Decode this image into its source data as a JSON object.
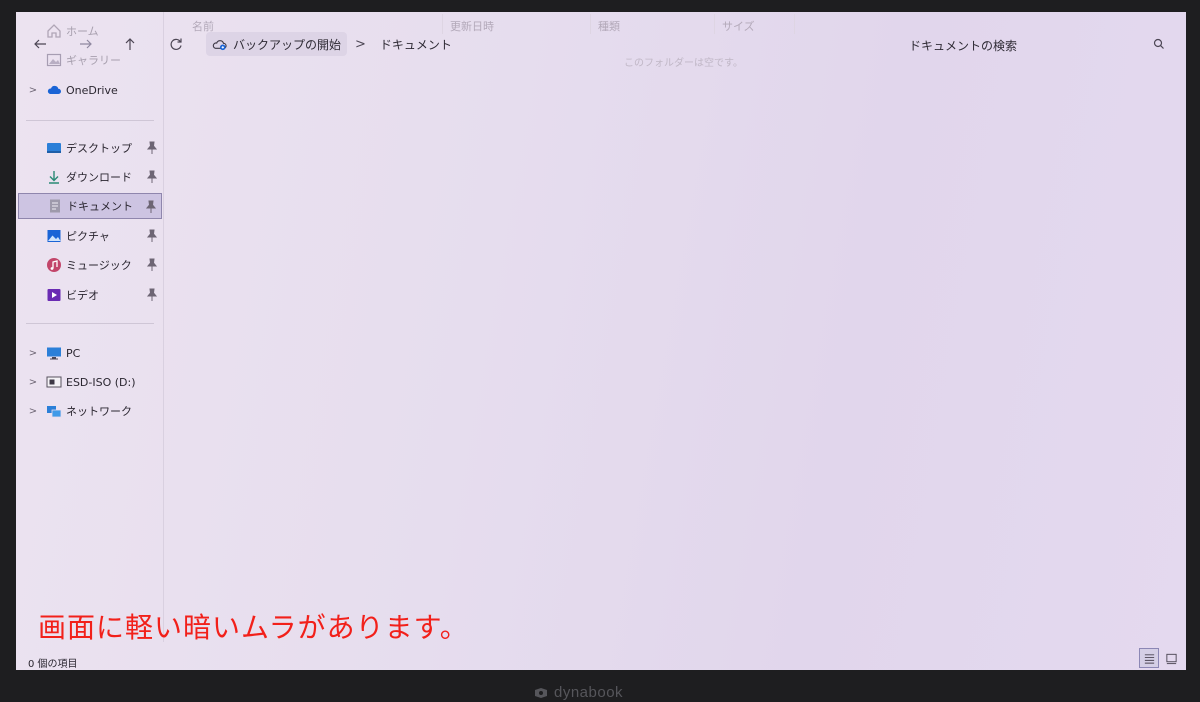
{
  "explorer": {
    "columns": {
      "name": "名前",
      "modified": "更新日時",
      "type": "種類",
      "size": "サイズ"
    },
    "empty_message": "このフォルダーは空です。",
    "breadcrumb": {
      "root": "バックアップの開始",
      "current": "ドキュメント"
    },
    "search_placeholder": "ドキュメントの検索"
  },
  "sidebar": {
    "top_items": [
      {
        "label": "ホーム",
        "icon": "home-icon"
      },
      {
        "label": "ギャラリー",
        "icon": "gallery-icon"
      }
    ],
    "onedrive": {
      "label": "OneDrive",
      "icon": "cloud-icon"
    },
    "quick_access": [
      {
        "label": "デスクトップ",
        "icon": "desktop-icon",
        "pinned": true
      },
      {
        "label": "ダウンロード",
        "icon": "download-icon",
        "pinned": true
      },
      {
        "label": "ドキュメント",
        "icon": "document-icon",
        "pinned": true,
        "selected": true
      },
      {
        "label": "ピクチャ",
        "icon": "pictures-icon",
        "pinned": true
      },
      {
        "label": "ミュージック",
        "icon": "music-icon",
        "pinned": true
      },
      {
        "label": "ビデオ",
        "icon": "video-icon",
        "pinned": true
      }
    ],
    "devices": [
      {
        "label": "PC",
        "icon": "pc-icon"
      },
      {
        "label": "ESD-ISO (D:)",
        "icon": "drive-icon"
      },
      {
        "label": "ネットワーク",
        "icon": "network-icon"
      }
    ]
  },
  "status_bar": {
    "item_count": "0 個の項目",
    "view_mode": "details"
  },
  "overlay_note": "画面に軽い暗いムラがあります。",
  "device_brand": "dynabook",
  "colors": {
    "accent": "#1a64d6",
    "note_text": "#f2201a",
    "screen_bg": "#e6ddee",
    "selected_bg": "#cdc4e2"
  }
}
